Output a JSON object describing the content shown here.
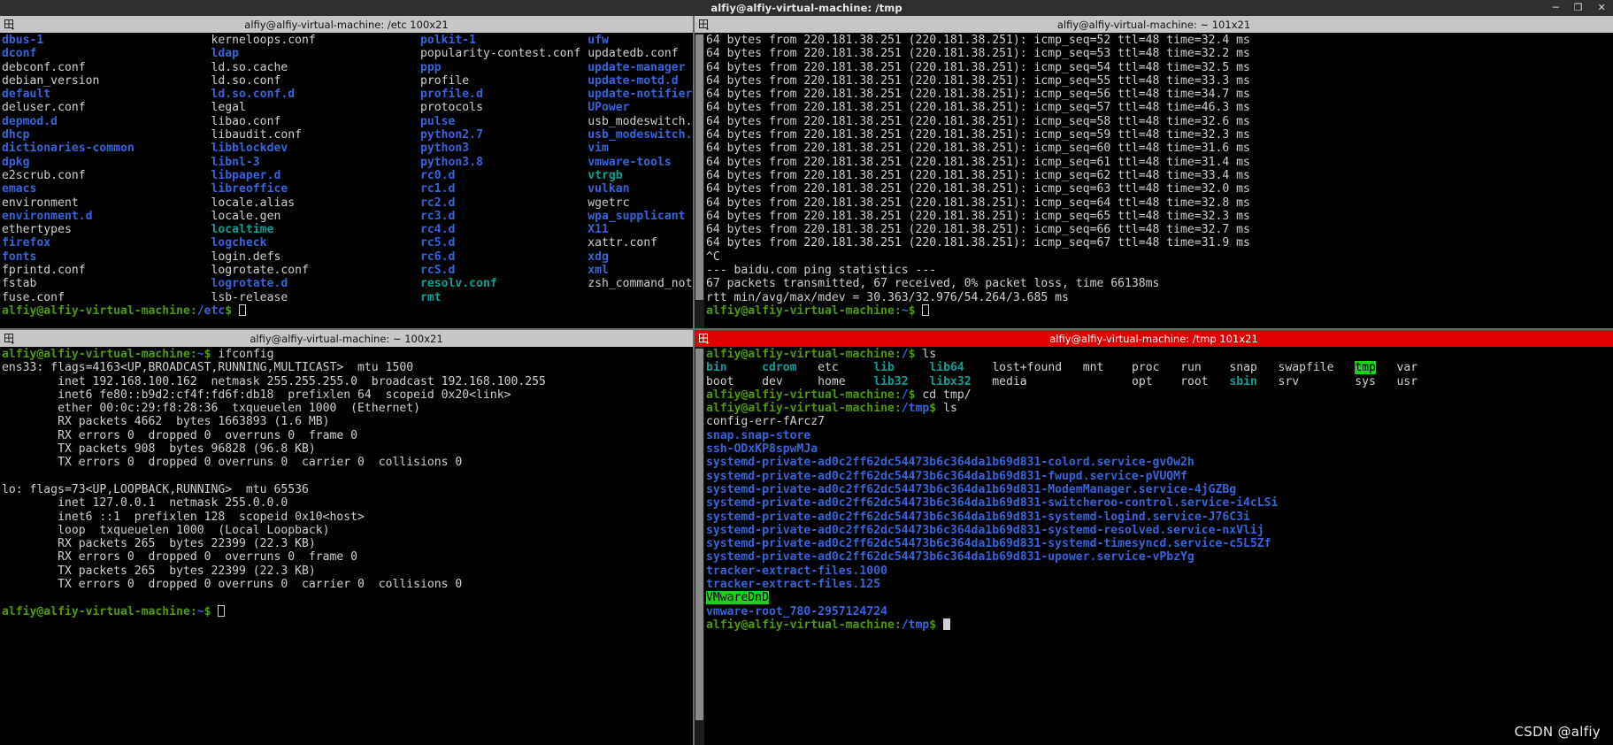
{
  "window": {
    "title": "alfiy@alfiy-virtual-machine: /tmp",
    "controls": {
      "minimize": "─",
      "maximize": "❐",
      "close": "✕"
    }
  },
  "watermark": "CSDN @alfiy",
  "panes": {
    "etc": {
      "title": "alfiy@alfiy-virtual-machine: /etc 100x21",
      "active": false,
      "prompt_user": "alfiy@alfiy-virtual-machine",
      "prompt_path": "/etc",
      "prompt_sym": "$",
      "columns": [
        [
          {
            "t": "dbus-1",
            "c": "blue"
          },
          {
            "t": "dconf",
            "c": "blue"
          },
          {
            "t": "debconf.conf",
            "c": "white"
          },
          {
            "t": "debian_version",
            "c": "white"
          },
          {
            "t": "default",
            "c": "blue"
          },
          {
            "t": "deluser.conf",
            "c": "white"
          },
          {
            "t": "depmod.d",
            "c": "blue"
          },
          {
            "t": "dhcp",
            "c": "blue"
          },
          {
            "t": "dictionaries-common",
            "c": "blue"
          },
          {
            "t": "dpkg",
            "c": "blue"
          },
          {
            "t": "e2scrub.conf",
            "c": "white"
          },
          {
            "t": "emacs",
            "c": "blue"
          },
          {
            "t": "environment",
            "c": "white"
          },
          {
            "t": "environment.d",
            "c": "blue"
          },
          {
            "t": "ethertypes",
            "c": "white"
          },
          {
            "t": "firefox",
            "c": "blue"
          },
          {
            "t": "fonts",
            "c": "blue"
          },
          {
            "t": "fprintd.conf",
            "c": "white"
          },
          {
            "t": "fstab",
            "c": "white"
          },
          {
            "t": "fuse.conf",
            "c": "white"
          }
        ],
        [
          {
            "t": "kerneloops.conf",
            "c": "white"
          },
          {
            "t": "ldap",
            "c": "blue"
          },
          {
            "t": "ld.so.cache",
            "c": "white"
          },
          {
            "t": "ld.so.conf",
            "c": "white"
          },
          {
            "t": "ld.so.conf.d",
            "c": "blue"
          },
          {
            "t": "legal",
            "c": "white"
          },
          {
            "t": "libao.conf",
            "c": "white"
          },
          {
            "t": "libaudit.conf",
            "c": "white"
          },
          {
            "t": "libblockdev",
            "c": "blue"
          },
          {
            "t": "libnl-3",
            "c": "blue"
          },
          {
            "t": "libpaper.d",
            "c": "blue"
          },
          {
            "t": "libreoffice",
            "c": "blue"
          },
          {
            "t": "locale.alias",
            "c": "white"
          },
          {
            "t": "locale.gen",
            "c": "white"
          },
          {
            "t": "localtime",
            "c": "cyan"
          },
          {
            "t": "logcheck",
            "c": "blue"
          },
          {
            "t": "login.defs",
            "c": "white"
          },
          {
            "t": "logrotate.conf",
            "c": "white"
          },
          {
            "t": "logrotate.d",
            "c": "blue"
          },
          {
            "t": "lsb-release",
            "c": "white"
          }
        ],
        [
          {
            "t": "polkit-1",
            "c": "blue"
          },
          {
            "t": "popularity-contest.conf",
            "c": "white"
          },
          {
            "t": "ppp",
            "c": "blue"
          },
          {
            "t": "profile",
            "c": "white"
          },
          {
            "t": "profile.d",
            "c": "blue"
          },
          {
            "t": "protocols",
            "c": "white"
          },
          {
            "t": "pulse",
            "c": "blue"
          },
          {
            "t": "python2.7",
            "c": "blue"
          },
          {
            "t": "python3",
            "c": "blue"
          },
          {
            "t": "python3.8",
            "c": "blue"
          },
          {
            "t": "rc0.d",
            "c": "blue"
          },
          {
            "t": "rc1.d",
            "c": "blue"
          },
          {
            "t": "rc2.d",
            "c": "blue"
          },
          {
            "t": "rc3.d",
            "c": "blue"
          },
          {
            "t": "rc4.d",
            "c": "blue"
          },
          {
            "t": "rc5.d",
            "c": "blue"
          },
          {
            "t": "rc6.d",
            "c": "blue"
          },
          {
            "t": "rcS.d",
            "c": "blue"
          },
          {
            "t": "resolv.conf",
            "c": "cyan"
          },
          {
            "t": "rmt",
            "c": "cyan"
          }
        ],
        [
          {
            "t": "ufw",
            "c": "blue"
          },
          {
            "t": "updatedb.conf",
            "c": "white"
          },
          {
            "t": "update-manager",
            "c": "blue"
          },
          {
            "t": "update-motd.d",
            "c": "blue"
          },
          {
            "t": "update-notifier",
            "c": "blue"
          },
          {
            "t": "UPower",
            "c": "blue"
          },
          {
            "t": "usb_modeswitch.conf",
            "c": "white"
          },
          {
            "t": "usb_modeswitch.d",
            "c": "blue"
          },
          {
            "t": "vim",
            "c": "blue"
          },
          {
            "t": "vmware-tools",
            "c": "blue"
          },
          {
            "t": "vtrgb",
            "c": "cyan"
          },
          {
            "t": "vulkan",
            "c": "blue"
          },
          {
            "t": "wgetrc",
            "c": "white"
          },
          {
            "t": "wpa_supplicant",
            "c": "blue"
          },
          {
            "t": "X11",
            "c": "blue"
          },
          {
            "t": "xattr.conf",
            "c": "white"
          },
          {
            "t": "xdg",
            "c": "blue"
          },
          {
            "t": "xml",
            "c": "blue"
          },
          {
            "t": "zsh_command_not_found",
            "c": "white"
          },
          {
            "t": "",
            "c": "white"
          }
        ]
      ]
    },
    "ping": {
      "title": "alfiy@alfiy-virtual-machine: ~ 101x21",
      "active": false,
      "prompt_user": "alfiy@alfiy-virtual-machine",
      "prompt_path": "~",
      "prompt_sym": "$",
      "reply_prefix": "64 bytes from 220.181.38.251 (220.181.38.251): ",
      "replies": [
        {
          "seq": "52",
          "ttl": "48",
          "time": "32.4"
        },
        {
          "seq": "53",
          "ttl": "48",
          "time": "32.2"
        },
        {
          "seq": "54",
          "ttl": "48",
          "time": "32.5"
        },
        {
          "seq": "55",
          "ttl": "48",
          "time": "33.3"
        },
        {
          "seq": "56",
          "ttl": "48",
          "time": "34.7"
        },
        {
          "seq": "57",
          "ttl": "48",
          "time": "46.3"
        },
        {
          "seq": "58",
          "ttl": "48",
          "time": "32.6"
        },
        {
          "seq": "59",
          "ttl": "48",
          "time": "32.3"
        },
        {
          "seq": "60",
          "ttl": "48",
          "time": "31.6"
        },
        {
          "seq": "61",
          "ttl": "48",
          "time": "31.4"
        },
        {
          "seq": "62",
          "ttl": "48",
          "time": "33.4"
        },
        {
          "seq": "63",
          "ttl": "48",
          "time": "32.0"
        },
        {
          "seq": "64",
          "ttl": "48",
          "time": "32.8"
        },
        {
          "seq": "65",
          "ttl": "48",
          "time": "32.3"
        },
        {
          "seq": "66",
          "ttl": "48",
          "time": "32.7"
        },
        {
          "seq": "67",
          "ttl": "48",
          "time": "31.9"
        }
      ],
      "interrupt": "^C",
      "stats_header": "--- baidu.com ping statistics ---",
      "stats_line": "67 packets transmitted, 67 received, 0% packet loss, time 66138ms",
      "rtt_line": "rtt min/avg/max/mdev = 30.363/32.976/54.264/3.685 ms"
    },
    "ifconfig": {
      "title": "alfiy@alfiy-virtual-machine: ~ 100x21",
      "active": false,
      "prompt_user": "alfiy@alfiy-virtual-machine",
      "prompt_path": "~",
      "prompt_sym": "$",
      "command": "ifconfig",
      "lines": [
        "ens33: flags=4163<UP,BROADCAST,RUNNING,MULTICAST>  mtu 1500",
        "        inet 192.168.100.162  netmask 255.255.255.0  broadcast 192.168.100.255",
        "        inet6 fe80::b9d2:cf4f:fd6f:db18  prefixlen 64  scopeid 0x20<link>",
        "        ether 00:0c:29:f8:28:36  txqueuelen 1000  (Ethernet)",
        "        RX packets 4662  bytes 1663893 (1.6 MB)",
        "        RX errors 0  dropped 0  overruns 0  frame 0",
        "        TX packets 908  bytes 96828 (96.8 KB)",
        "        TX errors 0  dropped 0 overruns 0  carrier 0  collisions 0",
        "",
        "lo: flags=73<UP,LOOPBACK,RUNNING>  mtu 65536",
        "        inet 127.0.0.1  netmask 255.0.0.0",
        "        inet6 ::1  prefixlen 128  scopeid 0x10<host>",
        "        loop  txqueuelen 1000  (Local Loopback)",
        "        RX packets 265  bytes 22399 (22.3 KB)",
        "        RX errors 0  dropped 0  overruns 0  frame 0",
        "        TX packets 265  bytes 22399 (22.3 KB)",
        "        TX errors 0  dropped 0 overruns 0  carrier 0  collisions 0",
        ""
      ]
    },
    "tmp": {
      "title": "alfiy@alfiy-virtual-machine: /tmp 101x21",
      "active": true,
      "prompt_user": "alfiy@alfiy-virtual-machine",
      "prompt_path_root": "/",
      "prompt_path_tmp": "/tmp",
      "prompt_sym": "$",
      "cmd_ls": "ls",
      "cmd_cd": "cd tmp/",
      "root_listing": [
        [
          {
            "t": "bin",
            "c": "cyan"
          },
          {
            "t": "cdrom",
            "c": "cyan"
          },
          {
            "t": "etc",
            "c": "white"
          },
          {
            "t": "lib",
            "c": "cyan"
          },
          {
            "t": "lib64",
            "c": "cyan"
          },
          {
            "t": "lost+found",
            "c": "white"
          },
          {
            "t": "mnt",
            "c": "white"
          },
          {
            "t": "proc",
            "c": "white"
          },
          {
            "t": "run",
            "c": "white"
          },
          {
            "t": "snap",
            "c": "white"
          },
          {
            "t": "swapfile",
            "c": "white"
          },
          {
            "t": "tmp",
            "c": "hl-green"
          },
          {
            "t": "var",
            "c": "white"
          }
        ],
        [
          {
            "t": "boot",
            "c": "white"
          },
          {
            "t": "dev",
            "c": "white"
          },
          {
            "t": "home",
            "c": "white"
          },
          {
            "t": "lib32",
            "c": "cyan"
          },
          {
            "t": "libx32",
            "c": "cyan"
          },
          {
            "t": "media",
            "c": "white"
          },
          {
            "t": "",
            "c": "white"
          },
          {
            "t": "opt",
            "c": "white"
          },
          {
            "t": "root",
            "c": "white"
          },
          {
            "t": "sbin",
            "c": "cyan"
          },
          {
            "t": "srv",
            "c": "white"
          },
          {
            "t": "sys",
            "c": "white"
          },
          {
            "t": "usr",
            "c": "white"
          }
        ]
      ],
      "tmp_listing": [
        {
          "t": "config-err-fArcz7",
          "c": "white"
        },
        {
          "t": "snap.snap-store",
          "c": "blue"
        },
        {
          "t": "ssh-ODxKP8spwMJa",
          "c": "blue"
        },
        {
          "t": "systemd-private-ad0c2ff62dc54473b6c364da1b69d831-colord.service-gvOw2h",
          "c": "blue"
        },
        {
          "t": "systemd-private-ad0c2ff62dc54473b6c364da1b69d831-fwupd.service-pVUQMf",
          "c": "blue"
        },
        {
          "t": "systemd-private-ad0c2ff62dc54473b6c364da1b69d831-ModemManager.service-4jGZBg",
          "c": "blue"
        },
        {
          "t": "systemd-private-ad0c2ff62dc54473b6c364da1b69d831-switcheroo-control.service-i4cLSi",
          "c": "blue"
        },
        {
          "t": "systemd-private-ad0c2ff62dc54473b6c364da1b69d831-systemd-logind.service-J76C3i",
          "c": "blue"
        },
        {
          "t": "systemd-private-ad0c2ff62dc54473b6c364da1b69d831-systemd-resolved.service-nxVlij",
          "c": "blue"
        },
        {
          "t": "systemd-private-ad0c2ff62dc54473b6c364da1b69d831-systemd-timesyncd.service-c5L5Zf",
          "c": "blue"
        },
        {
          "t": "systemd-private-ad0c2ff62dc54473b6c364da1b69d831-upower.service-vPbzYg",
          "c": "blue"
        },
        {
          "t": "tracker-extract-files.1000",
          "c": "blue"
        },
        {
          "t": "tracker-extract-files.125",
          "c": "blue"
        },
        {
          "t": "VMwareDnD",
          "c": "hl-green"
        },
        {
          "t": "vmware-root_780-2957124724",
          "c": "blue"
        }
      ]
    }
  }
}
